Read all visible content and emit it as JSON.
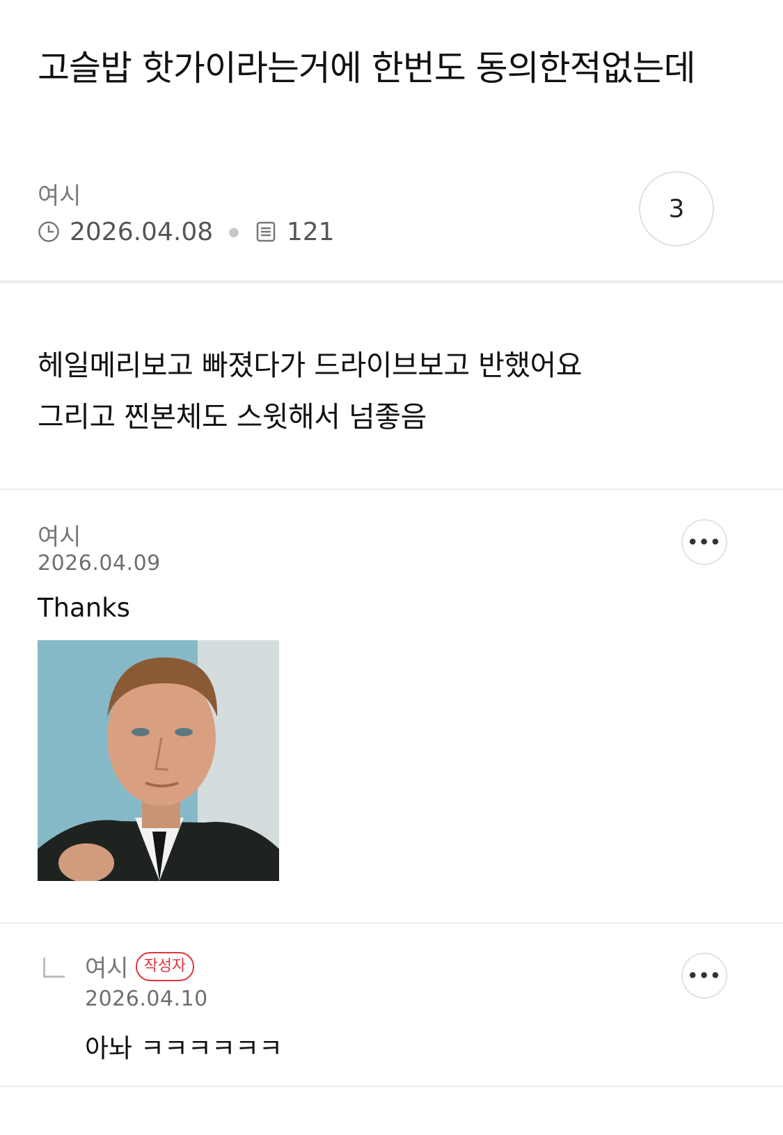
{
  "post": {
    "title": "고슬밥 핫가이라는거에 한번도 동의한적없는데",
    "author": "여시",
    "date": "2026.04.08",
    "views": "121",
    "comment_count": "3",
    "body_lines": [
      "헤일메리보고 빠졌다가 드라이브보고 반했어요",
      "그리고 찐본체도 스윗해서 넘좋음"
    ]
  },
  "comments": [
    {
      "author": "여시",
      "date": "2026.04.09",
      "text": "Thanks",
      "more": "•••"
    },
    {
      "author": "여시",
      "badge": "작성자",
      "date": "2026.04.10",
      "text": "아놔 ㅋㅋㅋㅋㅋㅋ",
      "more": "•••"
    }
  ],
  "icons": {
    "clock": "clock-icon",
    "views": "document-icon",
    "reply": "reply-arrow-icon",
    "more": "more-dots-icon"
  },
  "colors": {
    "badge": "#e0353b",
    "divider": "#ececec",
    "meta": "#555555"
  }
}
